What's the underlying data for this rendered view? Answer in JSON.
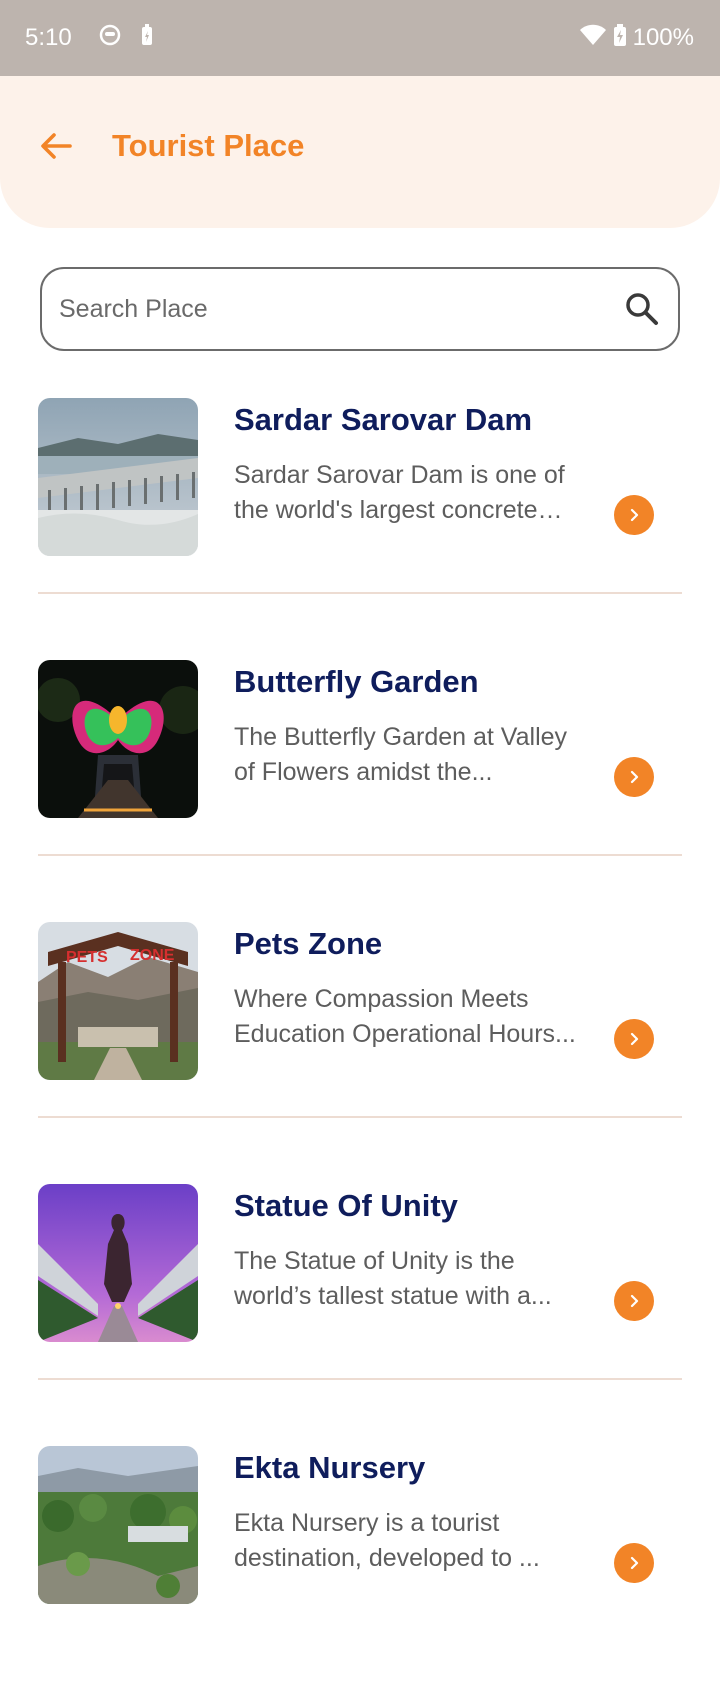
{
  "status_bar": {
    "time": "5:10",
    "battery": "100%"
  },
  "header": {
    "title": "Tourist Place"
  },
  "search": {
    "placeholder": "Search Place"
  },
  "places": [
    {
      "title": "Sardar Sarovar Dam",
      "description": "Sardar Sarovar Dam is one of the world's largest concrete dams..."
    },
    {
      "title": "Butterfly Garden",
      "description": "The Butterfly Garden at Valley of Flowers amidst the..."
    },
    {
      "title": "Pets Zone",
      "description": "Where Compassion Meets Education Operational Hours..."
    },
    {
      "title": "Statue Of Unity",
      "description": "The Statue of Unity is the world’s tallest statue with a..."
    },
    {
      "title": "Ekta Nursery",
      "description": "Ekta Nursery is a tourist destination, developed to ..."
    }
  ],
  "colors": {
    "accent": "#f28427",
    "title": "#0f1d5c",
    "header_bg": "#fdf2ea"
  }
}
